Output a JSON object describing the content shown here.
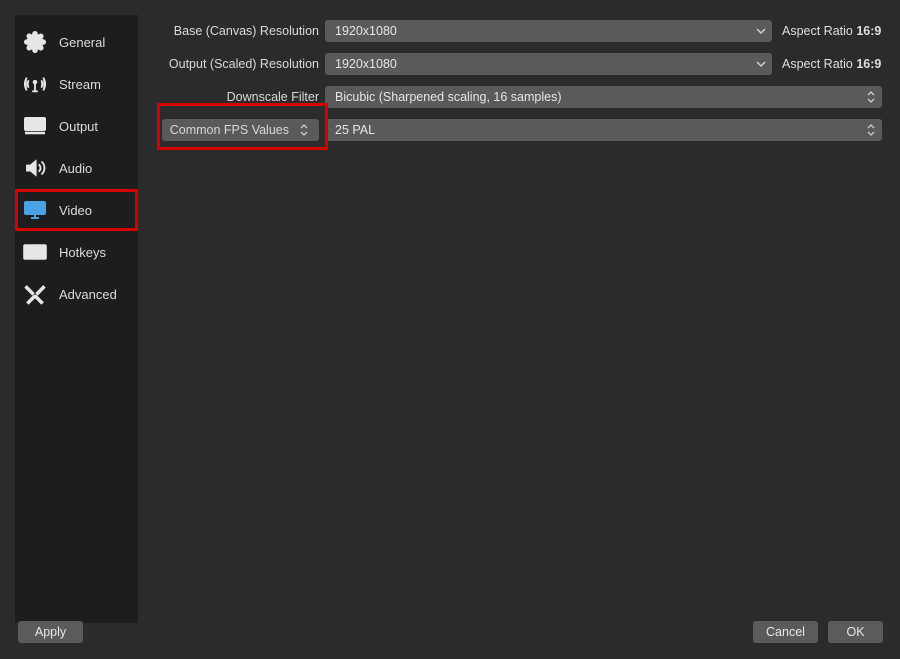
{
  "sidebar": {
    "items": [
      {
        "label": "General",
        "icon": "gear-icon"
      },
      {
        "label": "Stream",
        "icon": "antenna-icon"
      },
      {
        "label": "Output",
        "icon": "output-icon"
      },
      {
        "label": "Audio",
        "icon": "speaker-icon"
      },
      {
        "label": "Video",
        "icon": "monitor-icon"
      },
      {
        "label": "Hotkeys",
        "icon": "keyboard-icon"
      },
      {
        "label": "Advanced",
        "icon": "tools-icon"
      }
    ],
    "selected": "Video"
  },
  "video": {
    "base_resolution_label": "Base (Canvas) Resolution",
    "base_resolution_value": "1920x1080",
    "base_aspect_label": "Aspect Ratio",
    "base_aspect_value": "16:9",
    "output_resolution_label": "Output (Scaled) Resolution",
    "output_resolution_value": "1920x1080",
    "output_aspect_label": "Aspect Ratio",
    "output_aspect_value": "16:9",
    "downscale_filter_label": "Downscale Filter",
    "downscale_filter_value": "Bicubic (Sharpened scaling, 16 samples)",
    "fps_type_label": "Common FPS Values",
    "fps_value": "25 PAL"
  },
  "buttons": {
    "apply": "Apply",
    "cancel": "Cancel",
    "ok": "OK"
  }
}
